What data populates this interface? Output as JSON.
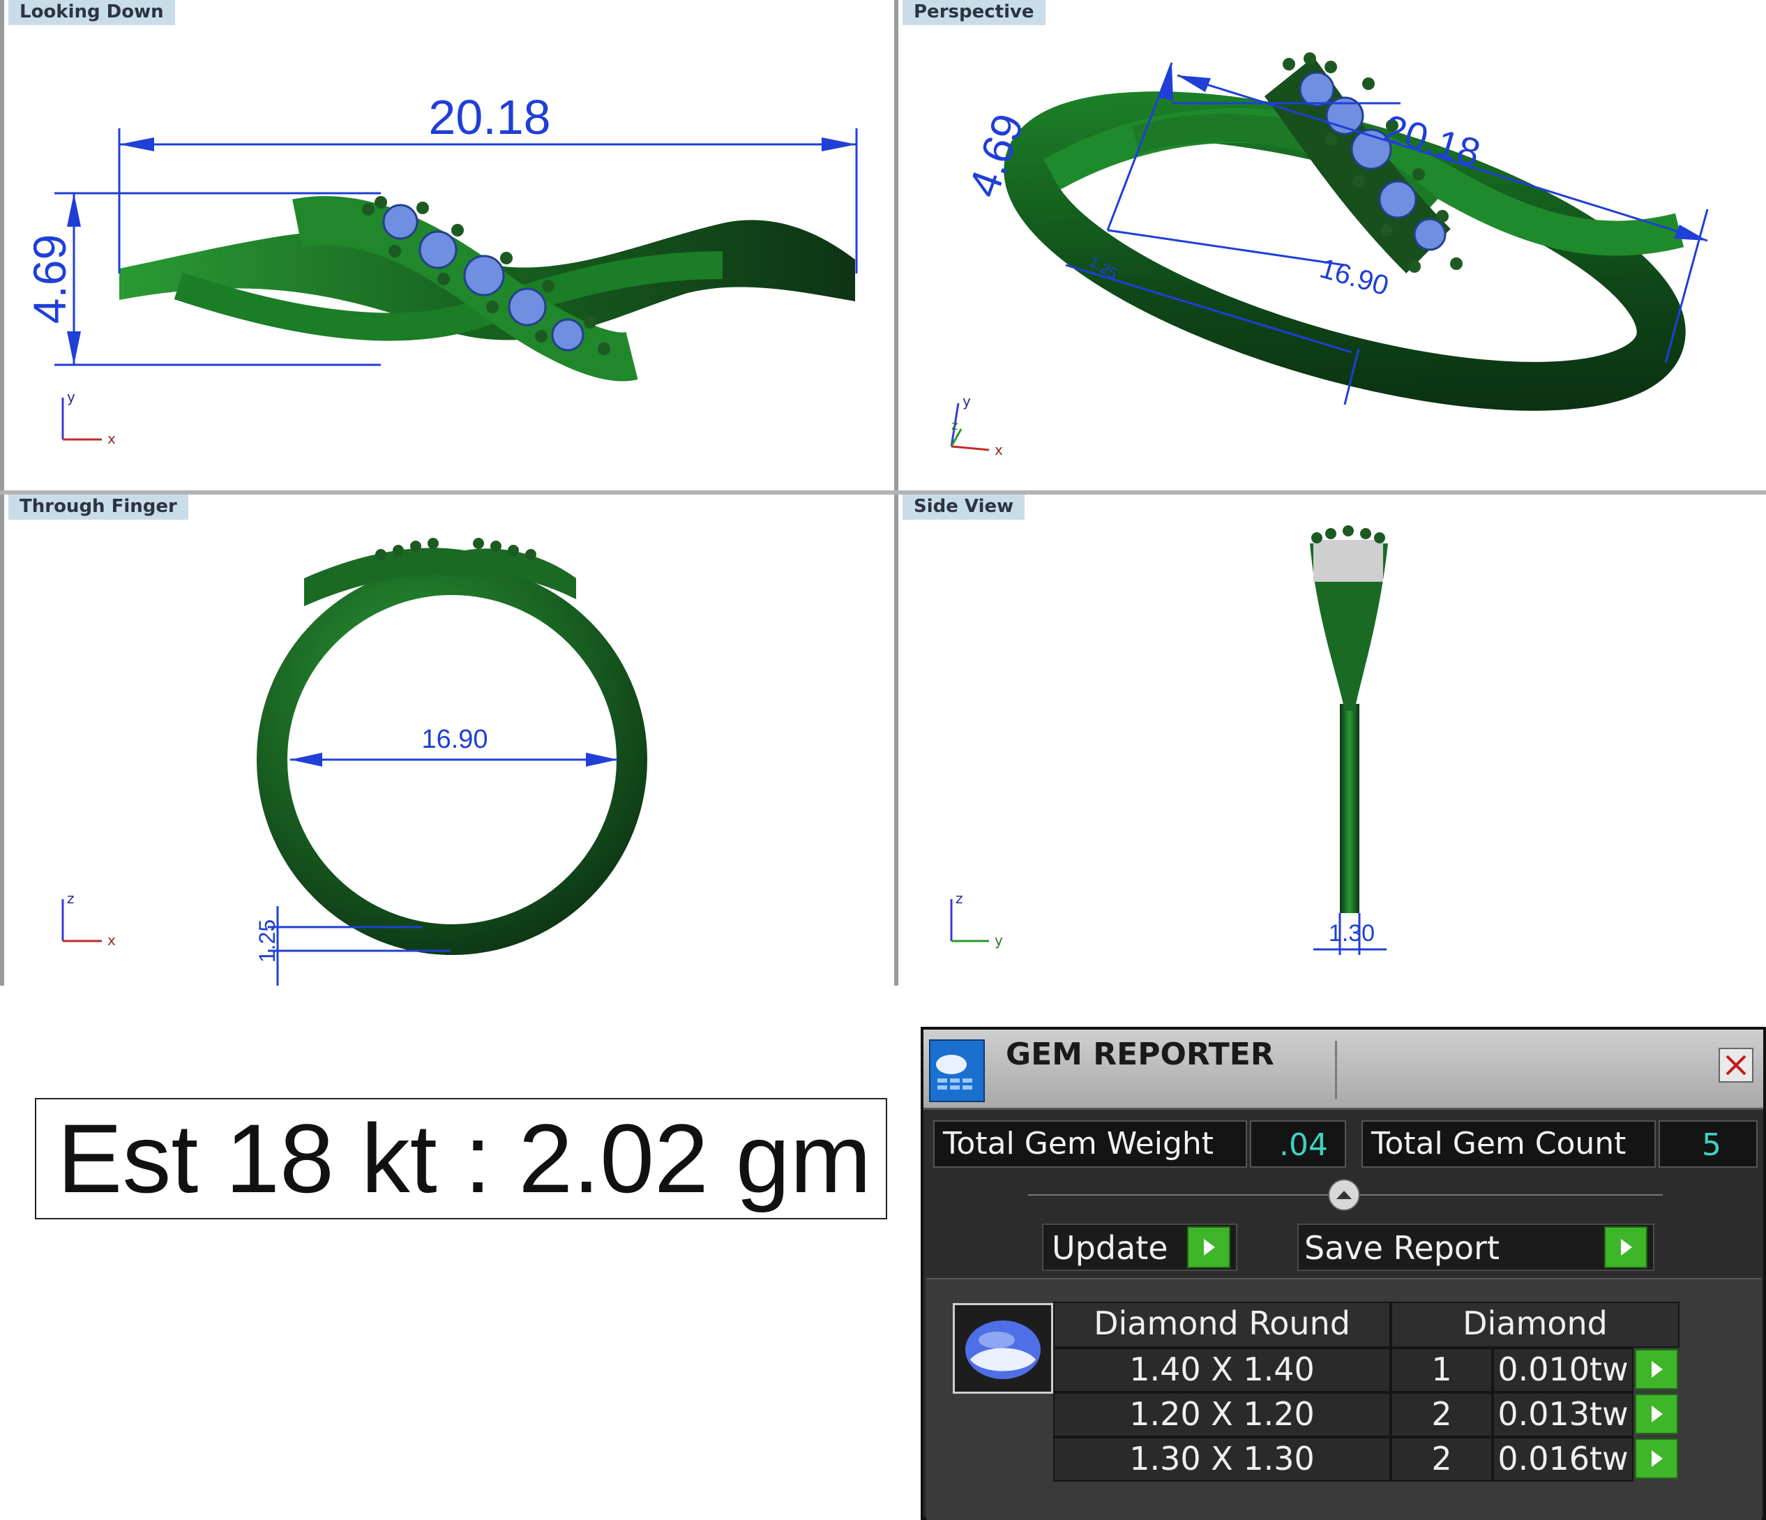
{
  "viewports": {
    "top_left": {
      "title": "Looking Down",
      "dim_width": "20.18",
      "dim_height": "4.69",
      "axis_up": "y",
      "axis_right": "x"
    },
    "top_right": {
      "title": "Perspective",
      "dim_height": "4.69",
      "dim_width": "20.18",
      "dim_inner": "16.90",
      "dim_small": "1.25",
      "axis_up": "y",
      "axis_side": "z",
      "axis_right": "x"
    },
    "bottom_left": {
      "title": "Through Finger",
      "dim_diameter": "16.90",
      "dim_thickness": "1.25",
      "axis_up": "z",
      "axis_right": "x"
    },
    "bottom_right": {
      "title": "Side View",
      "dim_width": "1.30",
      "axis_up": "z",
      "axis_right": "y"
    }
  },
  "weight_estimate": {
    "text": "Est 18 kt : 2.02 gm"
  },
  "gem_reporter": {
    "title": "GEM REPORTER",
    "total_weight_label": "Total Gem Weight",
    "total_weight_value": ".04",
    "total_count_label": "Total Gem Count",
    "total_count_value": "5",
    "update_label": "Update",
    "save_label": "Save Report",
    "table": {
      "col_shape": "Diamond Round",
      "col_type": "Diamond",
      "rows": [
        {
          "size": "1.40 X 1.40",
          "count": "1",
          "weight": "0.010tw"
        },
        {
          "size": "1.20 X 1.20",
          "count": "2",
          "weight": "0.013tw"
        },
        {
          "size": "1.30 X 1.30",
          "count": "2",
          "weight": "0.016tw"
        }
      ]
    }
  },
  "colors": {
    "metal": "#1f7a2a",
    "metal_dark": "#0e3415",
    "dimension": "#1f3fd6",
    "gem": "#5b7fd8"
  }
}
